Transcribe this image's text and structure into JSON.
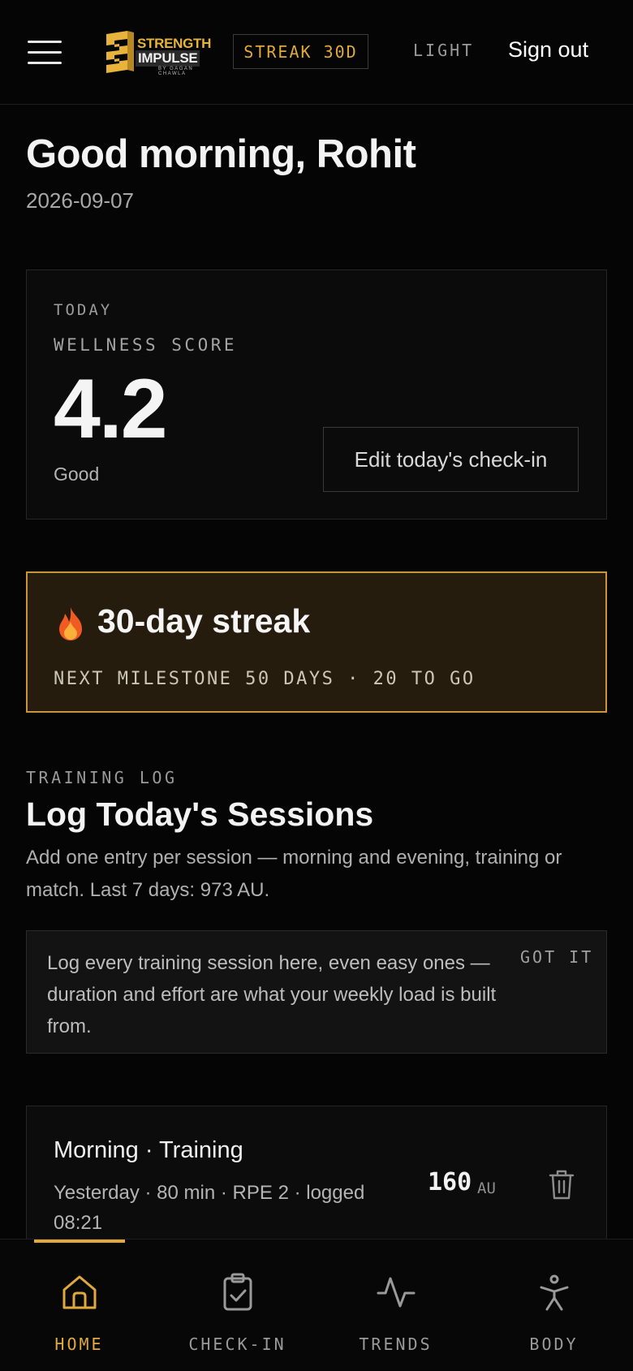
{
  "header": {
    "logo": {
      "line1": "STRENGTH",
      "line2": "IMPULSE",
      "line3": "BY GAGAN CHAWLA"
    },
    "streak_badge": "STREAK 30D",
    "theme_toggle": "LIGHT",
    "sign_out": "Sign out"
  },
  "greeting": {
    "title": "Good morning, Rohit",
    "date": "2026-09-07"
  },
  "wellness": {
    "kicker": "TODAY",
    "label": "WELLNESS SCORE",
    "score": "4.2",
    "status": "Good",
    "edit_button": "Edit today's check-in"
  },
  "streak": {
    "icon": "fire-icon",
    "title": "30-day streak",
    "next_milestone": "NEXT MILESTONE 50 DAYS · 20 TO GO"
  },
  "training_log": {
    "kicker": "TRAINING LOG",
    "title": "Log Today's Sessions",
    "description": "Add one entry per session — morning and evening, training or match. Last 7 days: 973 AU.",
    "tip": {
      "text": "Log every training session here, even easy ones — duration and effort are what your weekly load is built from.",
      "dismiss": "GOT IT"
    },
    "sessions": [
      {
        "title": "Morning · Training",
        "meta": "Yesterday · 80 min · RPE 2 · logged 08:21",
        "load": "160",
        "unit": "AU"
      }
    ]
  },
  "nav": {
    "items": [
      {
        "label": "HOME",
        "icon": "home-icon",
        "active": true
      },
      {
        "label": "CHECK-IN",
        "icon": "clipboard-check-icon",
        "active": false
      },
      {
        "label": "TRENDS",
        "icon": "activity-icon",
        "active": false
      },
      {
        "label": "BODY",
        "icon": "person-icon",
        "active": false
      }
    ]
  },
  "colors": {
    "accent": "#e0a93a",
    "background": "#050505",
    "streak_bg": "#261c0d"
  }
}
